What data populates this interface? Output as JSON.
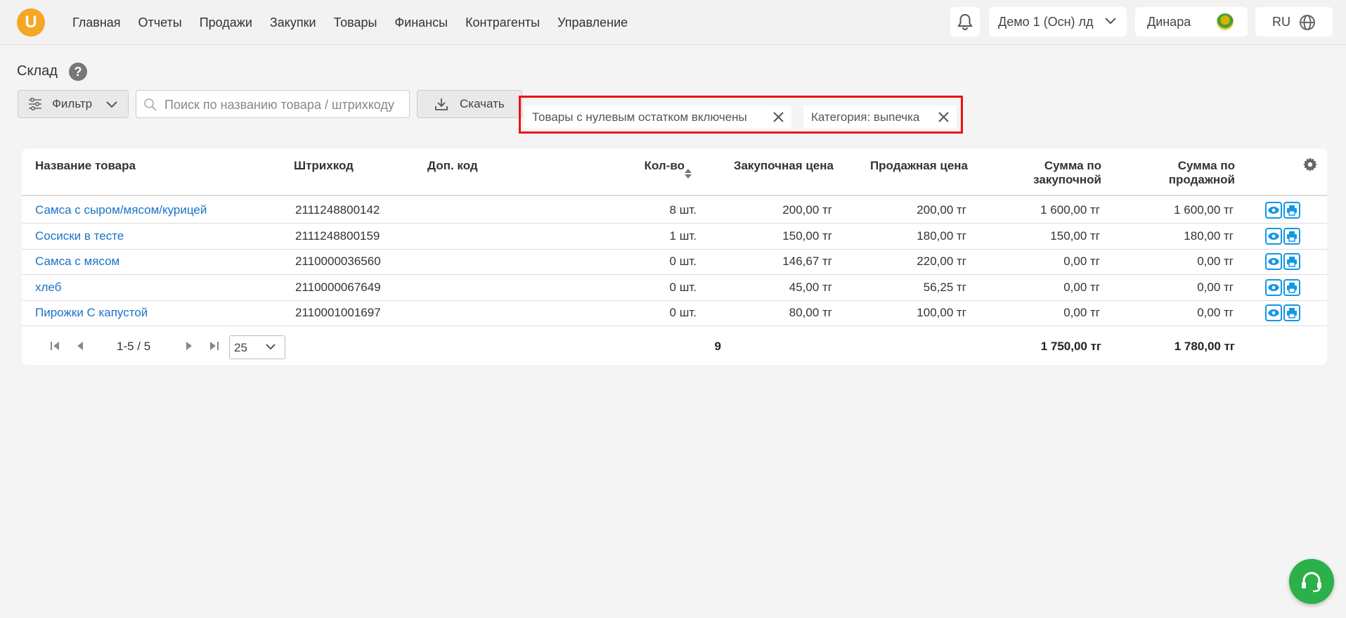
{
  "nav": {
    "logo_letter": "U",
    "items": [
      "Главная",
      "Отчеты",
      "Продажи",
      "Закупки",
      "Товары",
      "Финансы",
      "Контрагенты",
      "Управление"
    ],
    "company": "Демо 1 (Осн) лд",
    "user": "Динара",
    "lang": "RU"
  },
  "page": {
    "title": "Склад",
    "help_glyph": "?"
  },
  "toolbar": {
    "filter_label": "Фильтр",
    "search_placeholder": "Поиск по названию товара / штрихкоду",
    "download_label": "Скачать"
  },
  "chips": [
    {
      "label": "Товары с нулевым остатком включены"
    },
    {
      "label": "Категория: выпечка"
    }
  ],
  "table": {
    "headers": {
      "name": "Название товара",
      "barcode": "Штрихкод",
      "extra_code": "Доп. код",
      "qty": "Кол-во",
      "purchase_price": "Закупочная цена",
      "sale_price": "Продажная цена",
      "sum_purchase_1": "Сумма по",
      "sum_purchase_2": "закупочной",
      "sum_sale_1": "Сумма по",
      "sum_sale_2": "продажной"
    },
    "rows": [
      {
        "name": "Самса с сыром/мясом/курицей",
        "barcode": "2111248800142",
        "extra_code": "",
        "qty": "8 шт.",
        "purchase_price": "200,00 тг",
        "sale_price": "200,00 тг",
        "sum_purchase": "1 600,00 тг",
        "sum_sale": "1 600,00 тг"
      },
      {
        "name": "Сосиски в тесте",
        "barcode": "2111248800159",
        "extra_code": "",
        "qty": "1 шт.",
        "purchase_price": "150,00 тг",
        "sale_price": "180,00 тг",
        "sum_purchase": "150,00 тг",
        "sum_sale": "180,00 тг"
      },
      {
        "name": "Самса с мясом",
        "barcode": "2110000036560",
        "extra_code": "",
        "qty": "0 шт.",
        "purchase_price": "146,67 тг",
        "sale_price": "220,00 тг",
        "sum_purchase": "0,00 тг",
        "sum_sale": "0,00 тг"
      },
      {
        "name": "хлеб",
        "barcode": "2110000067649",
        "extra_code": "",
        "qty": "0 шт.",
        "purchase_price": "45,00 тг",
        "sale_price": "56,25 тг",
        "sum_purchase": "0,00 тг",
        "sum_sale": "0,00 тг"
      },
      {
        "name": "Пирожки С капустой",
        "barcode": "2110001001697",
        "extra_code": "",
        "qty": "0 шт.",
        "purchase_price": "80,00 тг",
        "sale_price": "100,00 тг",
        "sum_purchase": "0,00 тг",
        "sum_sale": "0,00 тг"
      }
    ]
  },
  "footer": {
    "range": "1-5 / 5",
    "page_size": "25",
    "total_qty": "9",
    "total_purchase": "1 750,00 тг",
    "total_sale": "1 780,00 тг"
  },
  "colors": {
    "accent": "#f5a623",
    "link": "#1a73c8",
    "highlight_border": "#e11111",
    "action_icon": "#1597e5",
    "support": "#2bb04a"
  },
  "icons": [
    "bell-icon",
    "chevron-down-icon",
    "globe-icon",
    "help-icon",
    "filter-sliders-icon",
    "search-icon",
    "download-icon",
    "close-icon",
    "sort-icon",
    "gear-icon",
    "eye-icon",
    "print-icon",
    "first-page-icon",
    "prev-page-icon",
    "next-page-icon",
    "last-page-icon",
    "headset-icon"
  ]
}
